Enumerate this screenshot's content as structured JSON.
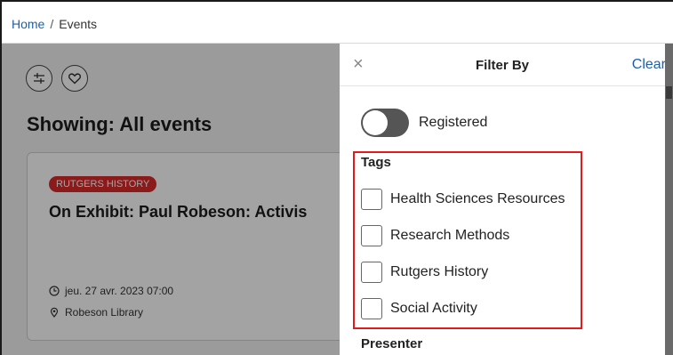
{
  "breadcrumb": {
    "home": "Home",
    "separator": "/",
    "current": "Events"
  },
  "main": {
    "heading": "Showing: All events",
    "card": {
      "badge": "RUTGERS HISTORY",
      "title": "On Exhibit: Paul Robeson: Activis",
      "datetime": "jeu. 27 avr. 2023 07:00",
      "location": "Robeson Library"
    }
  },
  "filter_panel": {
    "close_icon": "close-icon",
    "title": "Filter By",
    "clear": "Clear",
    "registered_label": "Registered",
    "tags_title": "Tags",
    "tags": [
      "Health Sciences Resources",
      "Research Methods",
      "Rutgers History",
      "Social Activity"
    ],
    "presenter_title": "Presenter"
  },
  "colors": {
    "link": "#1f5fa8",
    "badge": "#d92a2a",
    "highlight": "#e31b1b"
  }
}
